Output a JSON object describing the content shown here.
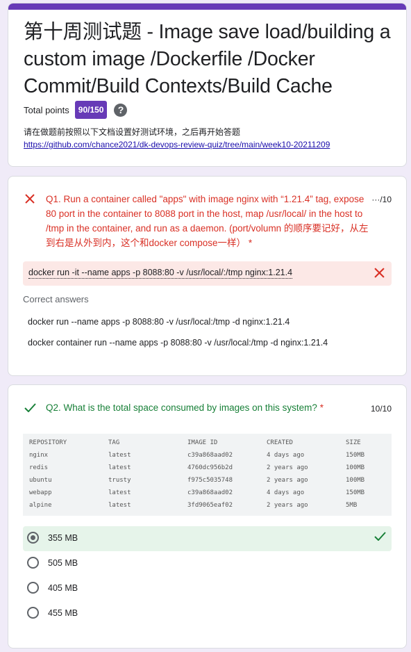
{
  "header": {
    "title": "第十周测试题 - Image save load/building a custom image /Dockerfile /Docker Commit/Build Contexts/Build Cache",
    "total_points_label": "Total points",
    "score": "90/150",
    "help_icon": "help-icon",
    "description": "请在做题前按照以下文档设置好测试环境，之后再开始答题",
    "link": "https://github.com/chance2021/dk-devops-review-quiz/tree/main/week10-20211209",
    "accent_color": "#673ab7"
  },
  "q1": {
    "status_icon": "cross-icon",
    "text": "Q1. Run a container called \"apps\" with image nginx with “1.21.4” tag, expose 80 port in the container to 8088 port in the host, map /usr/local/ in the host to /tmp in the container, and run as a daemon. (port/volumn 的顺序要记好，从左到右是从外到内，这个和docker compose一样）",
    "required": "*",
    "points": "···/10",
    "answer": "docker run -it --name apps -p 8088:80 -v /usr/local/:/tmp nginx:1.21.4",
    "correct_label": "Correct answers",
    "correct_answers": [
      "docker run --name apps -p 8088:80 -v /usr/local:/tmp -d nginx:1.21.4",
      "docker container run --name apps -p 8088:80 -v /usr/local:/tmp -d nginx:1.21.4"
    ],
    "wrong_color": "#d93025"
  },
  "q2": {
    "status_icon": "check-icon",
    "text": "Q2. What is the total space consumed by images on this system?",
    "required": "*",
    "points": "10/10",
    "correct_color": "#188038",
    "table": {
      "headers": [
        "REPOSITORY",
        "TAG",
        "IMAGE ID",
        "CREATED",
        "SIZE"
      ],
      "rows": [
        [
          "nginx",
          "latest",
          "c39a868aad02",
          "4 days ago",
          "150MB"
        ],
        [
          "redis",
          "latest",
          "4760dc956b2d",
          "2 years ago",
          "100MB"
        ],
        [
          "ubuntu",
          "trusty",
          "f975c5035748",
          "2 years ago",
          "100MB"
        ],
        [
          "webapp",
          "latest",
          "c39a868aad02",
          "4 days ago",
          "150MB"
        ],
        [
          "alpine",
          "latest",
          "3fd9065eaf02",
          "2 years ago",
          "5MB"
        ]
      ]
    },
    "options": [
      {
        "label": "355 MB",
        "selected": true,
        "correct": true
      },
      {
        "label": "505 MB",
        "selected": false,
        "correct": false
      },
      {
        "label": "405 MB",
        "selected": false,
        "correct": false
      },
      {
        "label": "455 MB",
        "selected": false,
        "correct": false
      }
    ]
  }
}
